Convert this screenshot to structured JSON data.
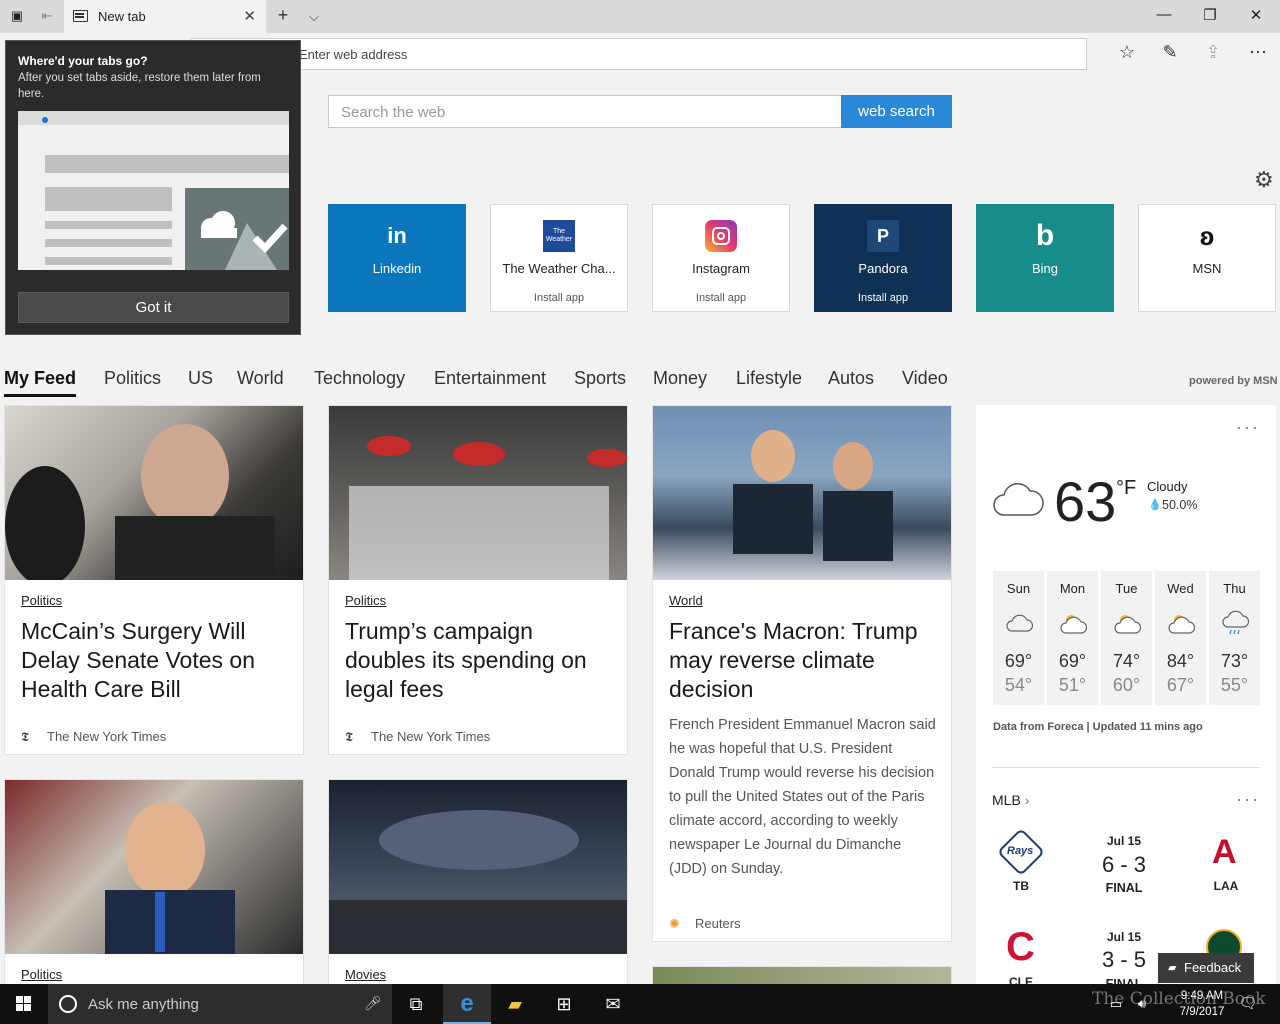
{
  "browser": {
    "tab_title": "New tab",
    "address_placeholder": "Enter web address"
  },
  "popup": {
    "title": "Where'd your tabs go?",
    "body": "After you set tabs aside, restore them later from here.",
    "button": "Got it"
  },
  "search": {
    "placeholder": "Search the web",
    "button": "web search"
  },
  "tiles": [
    {
      "label": "Linkedin",
      "sub": "",
      "bg": "#0a77bd"
    },
    {
      "label": "The Weather Cha...",
      "sub": "Install app",
      "bg": "#ffffff"
    },
    {
      "label": "Instagram",
      "sub": "Install app",
      "bg": "#ffffff"
    },
    {
      "label": "Pandora",
      "sub": "Install app",
      "bg": "#0f3155"
    },
    {
      "label": "Bing",
      "sub": "",
      "bg": "#168d8b"
    },
    {
      "label": "MSN",
      "sub": "",
      "bg": "#ffffff"
    }
  ],
  "nav": {
    "items": [
      "My Feed",
      "Politics",
      "US",
      "World",
      "Technology",
      "Entertainment",
      "Sports",
      "Money",
      "Lifestyle",
      "Autos",
      "Video"
    ],
    "powered": "powered by MSN"
  },
  "cards": [
    {
      "category": "Politics",
      "title": "McCain’s Surgery Will Delay Senate Votes on Health Care Bill",
      "source": "The New York Times"
    },
    {
      "category": "Politics",
      "title": "Trump’s campaign doubles its spending on legal fees",
      "source": "The New York Times"
    },
    {
      "category": "World",
      "title": "France's Macron: Trump may reverse climate decision",
      "desc": "French President Emmanuel Macron said he was hopeful that U.S. President Donald Trump would reverse his decision to pull the United States out of the Paris climate accord, according to weekly newspaper Le Journal du Dimanche (JDD) on Sunday.",
      "source": "Reuters"
    },
    {
      "category": "Politics"
    },
    {
      "category": "Movies"
    }
  ],
  "weather": {
    "temp": "63",
    "unit": "°F",
    "condition": "Cloudy",
    "precip": "50.0%",
    "forecast": [
      {
        "day": "Sun",
        "hi": "69°",
        "lo": "54°",
        "icon": "cloudy-icon"
      },
      {
        "day": "Mon",
        "hi": "69°",
        "lo": "51°",
        "icon": "partly-sunny-icon"
      },
      {
        "day": "Tue",
        "hi": "74°",
        "lo": "60°",
        "icon": "partly-sunny-icon"
      },
      {
        "day": "Wed",
        "hi": "84°",
        "lo": "67°",
        "icon": "partly-sunny-icon"
      },
      {
        "day": "Thu",
        "hi": "73°",
        "lo": "55°",
        "icon": "rain-icon"
      }
    ],
    "source": "Data from Foreca | Updated 11 mins ago"
  },
  "mlb": {
    "title": "MLB",
    "games": [
      {
        "date": "Jul 15",
        "score": "6 - 3",
        "status": "FINAL",
        "home": "TB",
        "away": "LAA"
      },
      {
        "date": "Jul 15",
        "score": "3 - 5",
        "status": "FINAL",
        "home": "CLE",
        "away": ""
      }
    ]
  },
  "feedback": "Feedback",
  "taskbar": {
    "cortana": "Ask me anything",
    "time": "9:49 AM",
    "date": "7/9/2017"
  },
  "watermark": "The Collection Book"
}
